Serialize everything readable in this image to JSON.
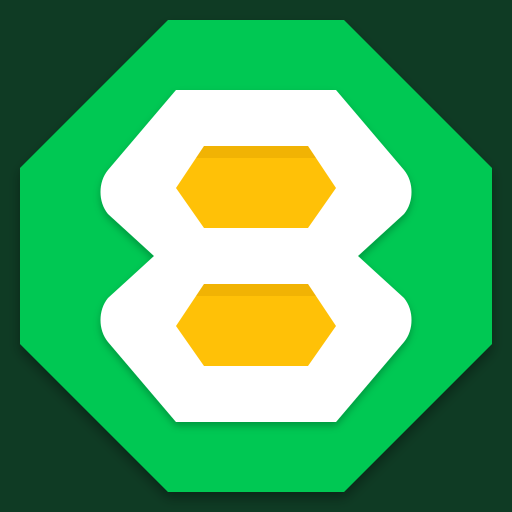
{
  "icon": {
    "name": "app-icon-octagon-8",
    "colors": {
      "background": "#0f3b24",
      "octagon": "#00c853",
      "octagon_shadow": "#009a3f",
      "glyph": "#ffffff",
      "glyph_shadow": "#d7d7d7",
      "fill": "#ffc107",
      "fill_shadow": "#d79a00"
    }
  }
}
